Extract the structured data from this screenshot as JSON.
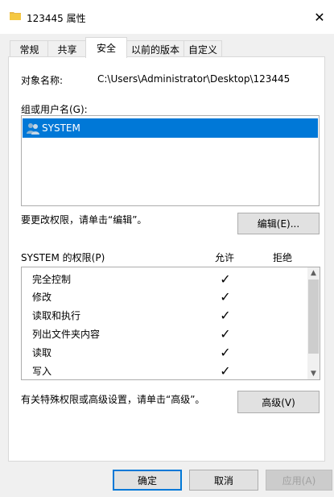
{
  "window": {
    "title": "123445 属性",
    "close_glyph": "✕"
  },
  "tabs": [
    {
      "label": "常规"
    },
    {
      "label": "共享"
    },
    {
      "label": "安全"
    },
    {
      "label": "以前的版本"
    },
    {
      "label": "自定义"
    }
  ],
  "security": {
    "object_name_label": "对象名称:",
    "object_name_value": "C:\\Users\\Administrator\\Desktop\\123445",
    "groups_label": "组或用户名(G):",
    "users": [
      {
        "name": "SYSTEM",
        "selected": true
      }
    ],
    "edit_hint": "要更改权限，请单击“编辑”。",
    "edit_button": "编辑(E)...",
    "permissions_title": "SYSTEM 的权限(P)",
    "allow_header": "允许",
    "deny_header": "拒绝",
    "permissions": [
      {
        "name": "完全控制",
        "allow": "✓",
        "deny": ""
      },
      {
        "name": "修改",
        "allow": "✓",
        "deny": ""
      },
      {
        "name": "读取和执行",
        "allow": "✓",
        "deny": ""
      },
      {
        "name": "列出文件夹内容",
        "allow": "✓",
        "deny": ""
      },
      {
        "name": "读取",
        "allow": "✓",
        "deny": ""
      },
      {
        "name": "写入",
        "allow": "✓",
        "deny": ""
      }
    ],
    "advanced_hint": "有关特殊权限或高级设置，请单击“高级”。",
    "advanced_button": "高级(V)"
  },
  "footer": {
    "ok": "确定",
    "cancel": "取消",
    "apply": "应用(A)"
  },
  "colors": {
    "selection": "#0078d7",
    "window_bg": "#f0f0f0",
    "panel_bg": "#ffffff"
  },
  "icons": {
    "title": "folder-icon",
    "user": "users-group-icon"
  }
}
